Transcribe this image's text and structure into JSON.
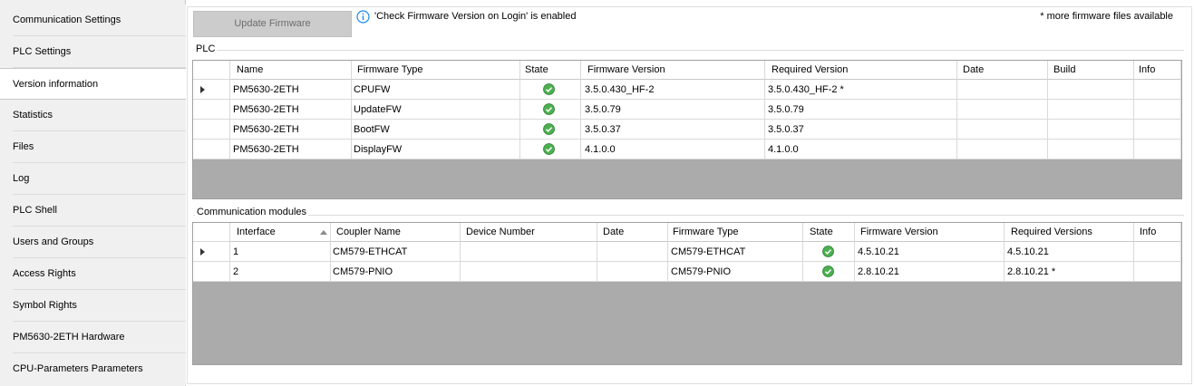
{
  "sidebar": {
    "items": [
      {
        "label": "Communication Settings"
      },
      {
        "label": "PLC Settings"
      },
      {
        "label": "Version information"
      },
      {
        "label": "Statistics"
      },
      {
        "label": "Files"
      },
      {
        "label": "Log"
      },
      {
        "label": "PLC Shell"
      },
      {
        "label": "Users and Groups"
      },
      {
        "label": "Access Rights"
      },
      {
        "label": "Symbol Rights"
      },
      {
        "label": "PM5630-2ETH Hardware"
      },
      {
        "label": "CPU-Parameters Parameters"
      }
    ],
    "active_index": 2
  },
  "toolbar": {
    "update_button": "Update Firmware",
    "info_icon": "info-icon",
    "info_text": "'Check Firmware Version on Login' is enabled",
    "more_text": "* more firmware files available"
  },
  "plc": {
    "group_label": "PLC",
    "columns": [
      "Name",
      "Firmware Type",
      "State",
      "Firmware Version",
      "Required Version",
      "Date",
      "Build",
      "Info"
    ],
    "rows": [
      {
        "name": "PM5630-2ETH",
        "type": "CPUFW",
        "state": "ok",
        "version": "3.5.0.430_HF-2",
        "required": "3.5.0.430_HF-2 *",
        "date": "",
        "build": "",
        "info": ""
      },
      {
        "name": "PM5630-2ETH",
        "type": "UpdateFW",
        "state": "ok",
        "version": "3.5.0.79",
        "required": "3.5.0.79",
        "date": "",
        "build": "",
        "info": ""
      },
      {
        "name": "PM5630-2ETH",
        "type": "BootFW",
        "state": "ok",
        "version": "3.5.0.37",
        "required": "3.5.0.37",
        "date": "",
        "build": "",
        "info": ""
      },
      {
        "name": "PM5630-2ETH",
        "type": "DisplayFW",
        "state": "ok",
        "version": "4.1.0.0",
        "required": "4.1.0.0",
        "date": "",
        "build": "",
        "info": ""
      }
    ]
  },
  "comm": {
    "group_label": "Communication modules",
    "columns": [
      "Interface",
      "Coupler Name",
      "Device Number",
      "Date",
      "Firmware Type",
      "State",
      "Firmware Version",
      "Required Versions",
      "Info"
    ],
    "rows": [
      {
        "interface": "1",
        "coupler": "CM579-ETHCAT",
        "device": "",
        "date": "",
        "type": "CM579-ETHCAT",
        "state": "ok",
        "version": "4.5.10.21",
        "required": "4.5.10.21",
        "info": ""
      },
      {
        "interface": "2",
        "coupler": "CM579-PNIO",
        "device": "",
        "date": "",
        "type": "CM579-PNIO",
        "state": "ok",
        "version": "2.8.10.21",
        "required": "2.8.10.21 *",
        "info": ""
      }
    ]
  },
  "colors": {
    "ok_green": "#4caf50",
    "info_blue": "#1e88e5",
    "grid_empty": "#ababab"
  }
}
